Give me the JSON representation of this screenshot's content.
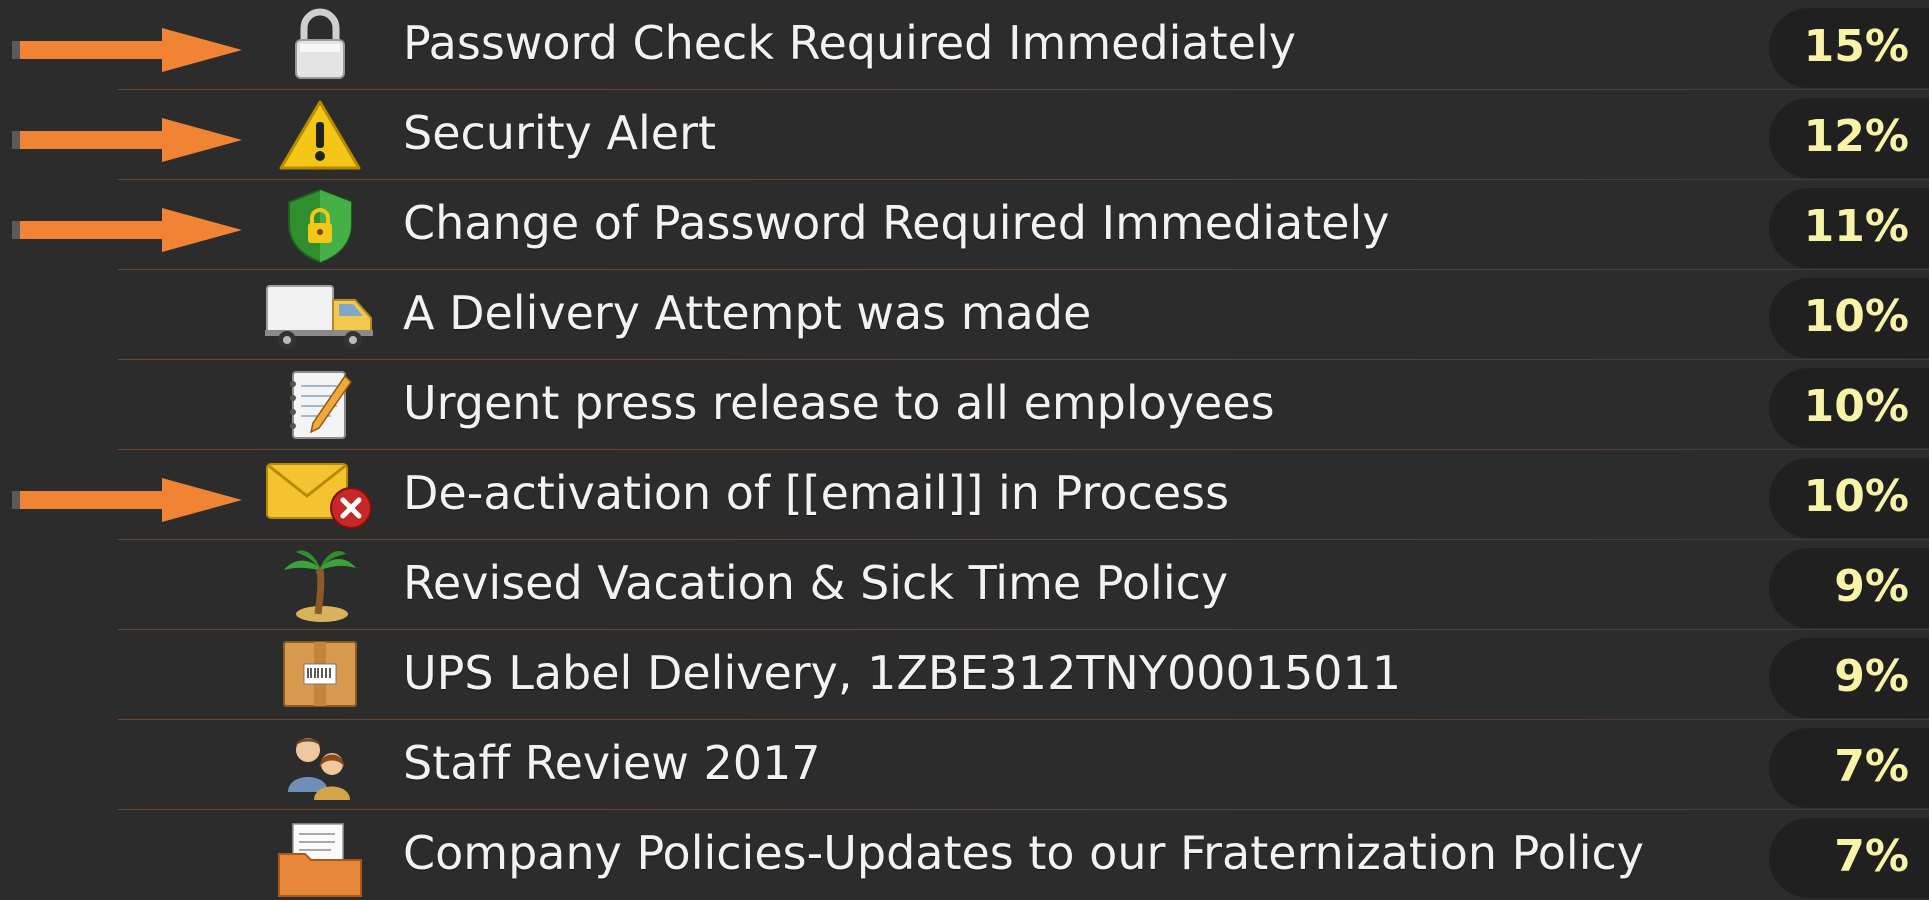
{
  "colors": {
    "background": "#2c2c2c",
    "arrow": "#f08434",
    "label": "#f2f2f2",
    "percent": "#f7f3a8"
  },
  "items": [
    {
      "label": "Password Check Required Immediately",
      "percent": "15%",
      "icon": "padlock-icon",
      "arrow": true
    },
    {
      "label": "Security Alert",
      "percent": "12%",
      "icon": "warning-icon",
      "arrow": true
    },
    {
      "label": "Change of Password Required Immediately",
      "percent": "11%",
      "icon": "shield-lock-icon",
      "arrow": true
    },
    {
      "label": "A Delivery Attempt was made",
      "percent": "10%",
      "icon": "delivery-truck-icon",
      "arrow": false
    },
    {
      "label": "Urgent press release to all employees",
      "percent": "10%",
      "icon": "notepad-pencil-icon",
      "arrow": false
    },
    {
      "label": "De-activation of [[email]] in Process",
      "percent": "10%",
      "icon": "envelope-error-icon",
      "arrow": true
    },
    {
      "label": "Revised Vacation & Sick Time Policy",
      "percent": "9%",
      "icon": "palm-tree-icon",
      "arrow": false
    },
    {
      "label": "UPS Label Delivery, 1ZBE312TNY00015011",
      "percent": "9%",
      "icon": "package-box-icon",
      "arrow": false
    },
    {
      "label": "Staff Review 2017",
      "percent": "7%",
      "icon": "staff-users-icon",
      "arrow": false
    },
    {
      "label": "Company Policies-Updates to our Fraternization Policy",
      "percent": "7%",
      "icon": "folder-document-icon",
      "arrow": false
    }
  ]
}
